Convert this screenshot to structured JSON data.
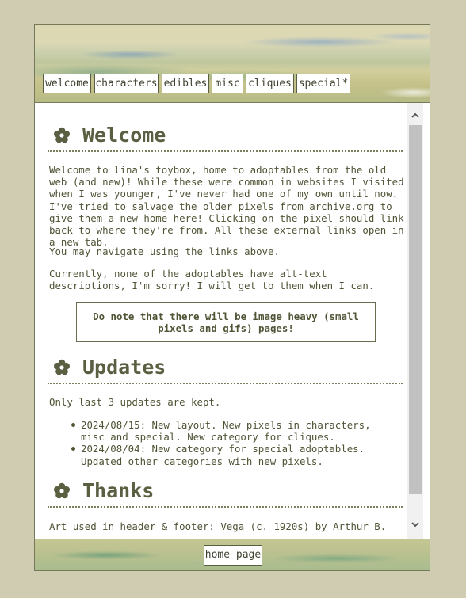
{
  "nav": {
    "links": [
      "welcome",
      "characters",
      "edibles",
      "misc",
      "cliques",
      "special*"
    ]
  },
  "welcome": {
    "title": "Welcome",
    "para1": "Welcome to lina's toybox, home to adoptables from the old web (and new)! While these were common in websites I visited when I was younger, I've never had one of my own until now. I've tried to salvage the older pixels from archive.org to give them a new home here! Clicking on the pixel should link back to where they're from. All these external links open in a new tab.",
    "para2": "You may navigate using the links above.",
    "para3": "Currently, none of the adoptables have alt-text descriptions, I'm sorry! I will get to them when I can.",
    "note": "Do note that there will be image heavy (small pixels and gifs) pages!"
  },
  "updates": {
    "title": "Updates",
    "intro": "Only last 3 updates are kept.",
    "items": [
      "2024/08/15: New layout. New pixels in characters, misc and special. New category for cliques.",
      "2024/08/04: New category for special adoptables. Updated other categories with new pixels."
    ]
  },
  "thanks": {
    "title": "Thanks",
    "para1": "Art used in header & footer: Vega (c. 1920s) by Arthur B."
  },
  "footer": {
    "home_label": "home page"
  },
  "icons": {
    "section": "flower-icon",
    "scroll_up": "arrow-up-icon",
    "scroll_down": "arrow-down-icon"
  },
  "colors": {
    "page_background": "#cfccb2",
    "text": "#4f5435",
    "heading": "#5b5f42",
    "border": "#76795a"
  }
}
